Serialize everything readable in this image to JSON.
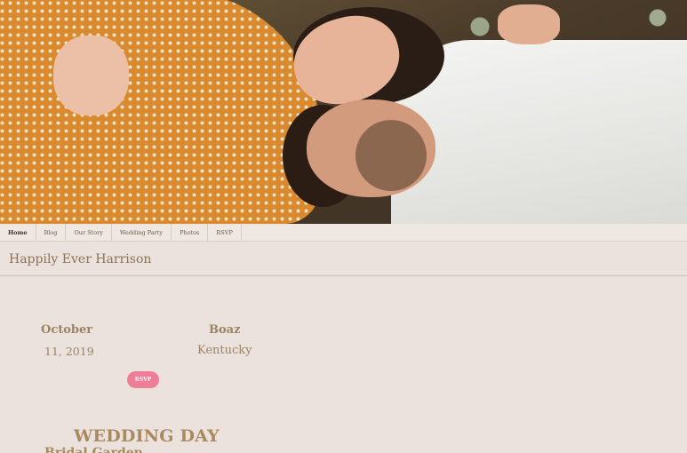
{
  "nav": {
    "items": [
      {
        "label": "Home",
        "active": true
      },
      {
        "label": "Blog"
      },
      {
        "label": "Our Story"
      },
      {
        "label": "Wedding Party"
      },
      {
        "label": "Photos"
      },
      {
        "label": "RSVP"
      }
    ]
  },
  "site": {
    "title": "Happily Ever Harrison"
  },
  "event": {
    "month": "October",
    "day_year": "11, 2019",
    "city": "Boaz",
    "state": "Kentucky",
    "rsvp_label": "RSVP"
  },
  "section": {
    "heading": "WEDDING DAY",
    "sub": "Bridal Garden"
  },
  "colors": {
    "background": "#ebe1dd",
    "accent": "#ef7d98",
    "text": "#9b8463"
  }
}
